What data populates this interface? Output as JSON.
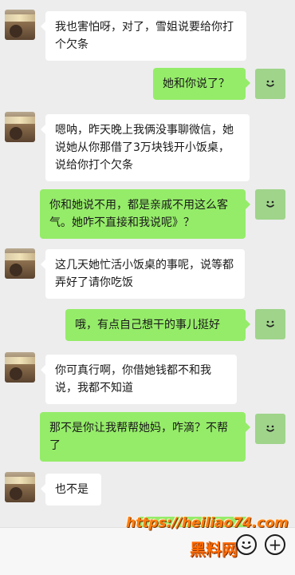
{
  "messages": [
    {
      "side": "left",
      "text": "我也害怕呀，对了，雪姐说要给你打个欠条"
    },
    {
      "side": "right",
      "text": "她和你说了？"
    },
    {
      "side": "left",
      "text": "嗯呐，昨天晚上我俩没事聊微信，她说她从你那借了3万块钱开小饭桌，说给你打个欠条"
    },
    {
      "side": "right",
      "text": "你和她说不用，都是亲戚不用这么客气。她咋不直接和我说呢》？"
    },
    {
      "side": "left",
      "text": "这几天她忙活小饭桌的事呢，说等都弄好了请你吃饭"
    },
    {
      "side": "right",
      "text": "哦，有点自己想干的事儿挺好"
    },
    {
      "side": "left",
      "text": "你可真行啊，你借她钱都不和我说，我都不知道"
    },
    {
      "side": "right",
      "text": "那不是你让我帮帮她妈，咋滴？不帮了"
    },
    {
      "side": "left",
      "text": "也不是"
    }
  ],
  "watermark": {
    "url": "https://heiliao74.com",
    "name": "黑料网"
  },
  "input_bar": {
    "emoji_icon": "smiley-icon",
    "plus_icon": "plus-icon",
    "plus_glyph": "+"
  },
  "colors": {
    "background": "#ededed",
    "bubble_self": "#95ec69",
    "bubble_other": "#ffffff",
    "watermark": "#ff7d10"
  }
}
